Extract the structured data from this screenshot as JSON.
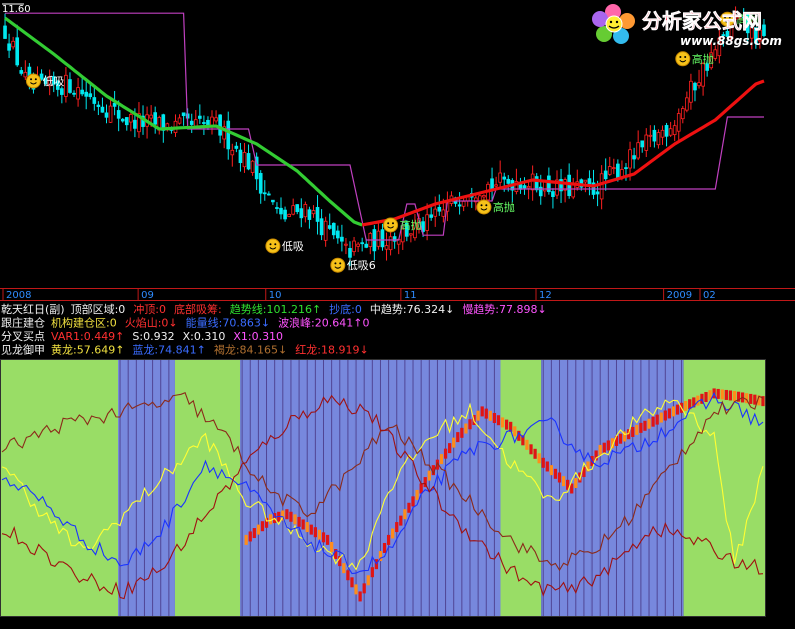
{
  "watermark": {
    "brand": "分析家公式网",
    "url": "www.88gs.com"
  },
  "colors": {
    "up": "#ff2020",
    "down": "#00e8f0",
    "ma_bull": "#ee1111",
    "ma_bear": "#33cc33",
    "bound": "#c040c0",
    "bg": "#000000",
    "green_band": "#99dd66",
    "blue_band": "#7788dd",
    "label_yellow": "#f8e830",
    "label_white": "#ffffff"
  },
  "price_panel": {
    "scale_label": "11.60",
    "date_axis": [
      "2008",
      "09",
      "10",
      "11",
      "12",
      "2009",
      "02"
    ],
    "annotations": [
      {
        "text": "低吸",
        "bar": 7,
        "price": 10.35,
        "color": "white"
      },
      {
        "text": "高抛",
        "bar": 95,
        "price": 7.95,
        "color": "green"
      },
      {
        "text": "低吸",
        "bar": 66,
        "price": 7.6,
        "color": "white"
      },
      {
        "text": "高抛",
        "bar": 118,
        "price": 8.25,
        "color": "green"
      },
      {
        "text": "低吸6",
        "bar": 82,
        "price": 7.28,
        "color": "white"
      },
      {
        "text": "高抛",
        "bar": 167,
        "price": 10.72,
        "color": "green"
      },
      {
        "text": "高抛",
        "bar": 178,
        "price": 11.38,
        "color": "green"
      }
    ]
  },
  "info_rows": [
    [
      {
        "text": "乾天红日(副)",
        "color": "white"
      },
      {
        "text": "顶部区域:0",
        "color": "white"
      },
      {
        "text": "冲顶:0",
        "color": "red"
      },
      {
        "text": "底部吸筹:",
        "color": "red"
      },
      {
        "text": "趋势线:101.216↑",
        "color": "green"
      },
      {
        "text": "抄底:0",
        "color": "blue"
      },
      {
        "text": "中趋势:76.324↓",
        "color": "white"
      },
      {
        "text": "慢趋势:77.898↓",
        "color": "magenta"
      }
    ],
    [
      {
        "text": "跟庄建仓",
        "color": "white"
      },
      {
        "text": "机构建仓区:0",
        "color": "yellow"
      },
      {
        "text": "火焰山:0↓",
        "color": "red"
      },
      {
        "text": "能量线:70.863↓",
        "color": "blue"
      },
      {
        "text": "波浪峰:20.641↑0",
        "color": "magenta"
      }
    ],
    [
      {
        "text": "分叉买点",
        "color": "white"
      },
      {
        "text": "VAR1:0.449↑",
        "color": "red"
      },
      {
        "text": "S:0.932",
        "color": "white"
      },
      {
        "text": "X:0.310",
        "color": "white"
      },
      {
        "text": "X1:0.310",
        "color": "magenta"
      }
    ],
    [
      {
        "text": "见龙御甲",
        "color": "white"
      },
      {
        "text": "黄龙:57.649↑",
        "color": "yellow"
      },
      {
        "text": "蓝龙:74.841↑",
        "color": "blue"
      },
      {
        "text": "褐龙:84.165↓",
        "color": "brown"
      },
      {
        "text": "红龙:18.919↓",
        "color": "red"
      }
    ]
  ],
  "chart_data": [
    {
      "type": "candlestick",
      "title": "",
      "x_tick_labels": [
        "2008",
        "09",
        "10",
        "11",
        "12",
        "2009",
        "02"
      ],
      "ylim": [
        7.0,
        11.6
      ],
      "bar_count": 188,
      "close_path": [
        [
          0,
          11.2
        ],
        [
          6,
          10.2
        ],
        [
          16,
          10.3
        ],
        [
          30,
          9.7
        ],
        [
          40,
          9.6
        ],
        [
          52,
          9.6
        ],
        [
          60,
          9.0
        ],
        [
          68,
          8.05
        ],
        [
          74,
          8.25
        ],
        [
          84,
          7.5
        ],
        [
          92,
          7.7
        ],
        [
          104,
          7.95
        ],
        [
          114,
          8.55
        ],
        [
          126,
          8.7
        ],
        [
          136,
          8.55
        ],
        [
          145,
          8.55
        ],
        [
          155,
          9.1
        ],
        [
          165,
          9.7
        ],
        [
          172,
          10.55
        ],
        [
          180,
          11.35
        ],
        [
          187,
          11.0
        ]
      ],
      "ma_path": [
        [
          0,
          11.4
        ],
        [
          12,
          10.8
        ],
        [
          25,
          10.1
        ],
        [
          38,
          9.55
        ],
        [
          52,
          9.6
        ],
        [
          62,
          9.3
        ],
        [
          72,
          8.85
        ],
        [
          80,
          8.35
        ],
        [
          86,
          8.0
        ],
        [
          88,
          7.95
        ],
        [
          96,
          8.05
        ],
        [
          106,
          8.3
        ],
        [
          118,
          8.5
        ],
        [
          130,
          8.7
        ],
        [
          145,
          8.6
        ],
        [
          155,
          8.8
        ],
        [
          165,
          9.3
        ],
        [
          175,
          9.7
        ],
        [
          185,
          10.3
        ],
        [
          187,
          10.35
        ]
      ],
      "ma_turn_bull_bar": 88,
      "bound_path": [
        [
          0,
          11.48
        ],
        [
          44,
          11.48
        ],
        [
          45,
          9.55
        ],
        [
          60,
          9.55
        ],
        [
          62,
          8.95
        ],
        [
          85,
          8.95
        ],
        [
          89,
          7.7
        ],
        [
          97,
          7.7
        ],
        [
          99,
          8.3
        ],
        [
          101,
          8.3
        ],
        [
          103,
          7.78
        ],
        [
          108,
          7.78
        ],
        [
          109,
          8.35
        ],
        [
          120,
          8.35
        ],
        [
          121,
          8.55
        ],
        [
          175,
          8.55
        ],
        [
          178,
          9.75
        ],
        [
          187,
          9.75
        ]
      ],
      "note": "Daily price series for roughly Aug 2008 – Feb 2009 with a moving-average trend line that turns from green to red at the November low."
    },
    {
      "type": "area",
      "title": "见龙御甲",
      "ylim": [
        0,
        100
      ],
      "band_pattern": [
        {
          "bars": [
            0,
            29
          ],
          "state": "green"
        },
        {
          "bars": [
            29,
            43
          ],
          "state": "blue"
        },
        {
          "bars": [
            43,
            59
          ],
          "state": "green"
        },
        {
          "bars": [
            59,
            87
          ],
          "state": "blue"
        },
        {
          "bars": [
            87,
            123
          ],
          "state": "blue"
        },
        {
          "bars": [
            123,
            133
          ],
          "state": "green"
        },
        {
          "bars": [
            133,
            145
          ],
          "state": "blue"
        },
        {
          "bars": [
            145,
            168
          ],
          "state": "blue"
        },
        {
          "bars": [
            168,
            188
          ],
          "state": "green"
        }
      ],
      "series": [
        {
          "name": "黄龙",
          "color": "yellow",
          "path": [
            [
              0,
              60
            ],
            [
              10,
              40
            ],
            [
              20,
              25
            ],
            [
              30,
              40
            ],
            [
              40,
              55
            ],
            [
              50,
              70
            ],
            [
              60,
              45
            ],
            [
              70,
              35
            ],
            [
              80,
              25
            ],
            [
              88,
              20
            ],
            [
              95,
              50
            ],
            [
              105,
              70
            ],
            [
              115,
              80
            ],
            [
              125,
              60
            ],
            [
              135,
              45
            ],
            [
              145,
              60
            ],
            [
              155,
              75
            ],
            [
              165,
              85
            ],
            [
              175,
              70
            ],
            [
              180,
              20
            ],
            [
              187,
              57.6
            ]
          ]
        },
        {
          "name": "蓝龙",
          "color": "blue",
          "path": [
            [
              0,
              55
            ],
            [
              10,
              45
            ],
            [
              20,
              30
            ],
            [
              30,
              20
            ],
            [
              40,
              35
            ],
            [
              50,
              60
            ],
            [
              60,
              50
            ],
            [
              70,
              35
            ],
            [
              80,
              25
            ],
            [
              88,
              18
            ],
            [
              95,
              25
            ],
            [
              105,
              50
            ],
            [
              115,
              65
            ],
            [
              125,
              70
            ],
            [
              135,
              75
            ],
            [
              145,
              60
            ],
            [
              155,
              65
            ],
            [
              165,
              75
            ],
            [
              175,
              85
            ],
            [
              182,
              80
            ],
            [
              187,
              74.8
            ]
          ]
        },
        {
          "name": "褐龙",
          "color": "brown",
          "path": [
            [
              0,
              65
            ],
            [
              15,
              75
            ],
            [
              30,
              80
            ],
            [
              45,
              85
            ],
            [
              55,
              70
            ],
            [
              65,
              50
            ],
            [
              75,
              40
            ],
            [
              85,
              55
            ],
            [
              95,
              75
            ],
            [
              105,
              60
            ],
            [
              115,
              45
            ],
            [
              125,
              30
            ],
            [
              135,
              20
            ],
            [
              145,
              25
            ],
            [
              155,
              40
            ],
            [
              165,
              60
            ],
            [
              175,
              80
            ],
            [
              187,
              84.2
            ]
          ]
        },
        {
          "name": "红龙",
          "color": "red",
          "path": [
            [
              0,
              35
            ],
            [
              10,
              25
            ],
            [
              20,
              15
            ],
            [
              30,
              10
            ],
            [
              40,
              20
            ],
            [
              50,
              40
            ],
            [
              60,
              60
            ],
            [
              70,
              75
            ],
            [
              80,
              85
            ],
            [
              90,
              80
            ],
            [
              100,
              60
            ],
            [
              110,
              40
            ],
            [
              120,
              25
            ],
            [
              130,
              12
            ],
            [
              140,
              10
            ],
            [
              150,
              20
            ],
            [
              160,
              35
            ],
            [
              170,
              30
            ],
            [
              180,
              22
            ],
            [
              187,
              18.9
            ]
          ]
        }
      ],
      "overlay_bars": {
        "name": "VAR1",
        "color": "red",
        "values_path": [
          [
            60,
            30
          ],
          [
            66,
            38
          ],
          [
            70,
            40
          ],
          [
            80,
            30
          ],
          [
            88,
            8
          ],
          [
            95,
            30
          ],
          [
            105,
            55
          ],
          [
            112,
            70
          ],
          [
            118,
            80
          ],
          [
            125,
            74
          ],
          [
            133,
            60
          ],
          [
            140,
            50
          ],
          [
            147,
            65
          ],
          [
            155,
            72
          ],
          [
            165,
            80
          ],
          [
            175,
            87
          ],
          [
            180,
            86
          ],
          [
            187,
            84
          ]
        ]
      }
    }
  ]
}
